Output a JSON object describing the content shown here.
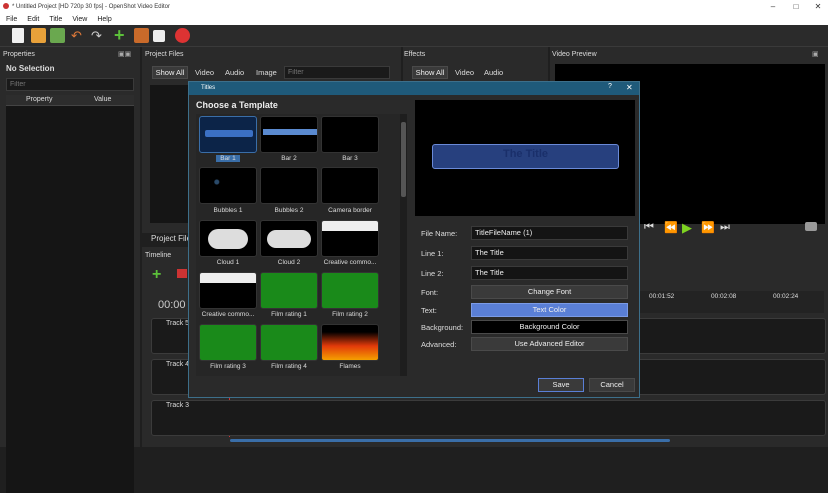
{
  "window": {
    "title": "* Untitled Project [HD 720p 30 fps] - OpenShot Video Editor"
  },
  "menu": [
    "File",
    "Edit",
    "Title",
    "View",
    "Help"
  ],
  "properties": {
    "title": "Properties",
    "no_selection": "No Selection",
    "filter_placeholder": "Filter",
    "col_property": "Property",
    "col_value": "Value"
  },
  "project_files": {
    "title": "Project Files",
    "tabs": [
      "Show All",
      "Video",
      "Audio",
      "Image"
    ],
    "filter_placeholder": "Filter",
    "partial_label": "Project File"
  },
  "effects": {
    "title": "Effects",
    "tabs": [
      "Show All",
      "Video",
      "Audio"
    ]
  },
  "video_preview": {
    "title": "Video Preview"
  },
  "timeline": {
    "title": "Timeline",
    "time": "00:00",
    "ruler": [
      "00:01:52",
      "00:02:08",
      "00:02:24"
    ],
    "tracks": [
      "Track 5",
      "Track 4",
      "Track 3"
    ]
  },
  "dialog": {
    "title": "Titles",
    "help": "?",
    "heading": "Choose a Template",
    "templates": [
      "Bar 1",
      "Bar 2",
      "Bar 3",
      "Bubbles 1",
      "Bubbles 2",
      "Camera border",
      "Cloud 1",
      "Cloud 2",
      "Creative commo...",
      "Creative commo...",
      "Film rating 1",
      "Film rating 2",
      "Film rating 3",
      "Film rating 4",
      "Flames"
    ],
    "preview_text": "The Title",
    "form": {
      "file_name_label": "File Name:",
      "file_name": "TitleFileName (1)",
      "line1_label": "Line 1:",
      "line1": "The Title",
      "line2_label": "Line 2:",
      "line2": "The Title",
      "font_label": "Font:",
      "font_btn": "Change Font",
      "text_label": "Text:",
      "text_btn": "Text Color",
      "bg_label": "Background:",
      "bg_btn": "Background Color",
      "adv_label": "Advanced:",
      "adv_btn": "Use Advanced Editor"
    },
    "save": "Save",
    "cancel": "Cancel"
  },
  "colors": {
    "accent": "#5a7fd6",
    "dialog_title": "#1f5a7a",
    "selection": "#3a6ea8"
  }
}
